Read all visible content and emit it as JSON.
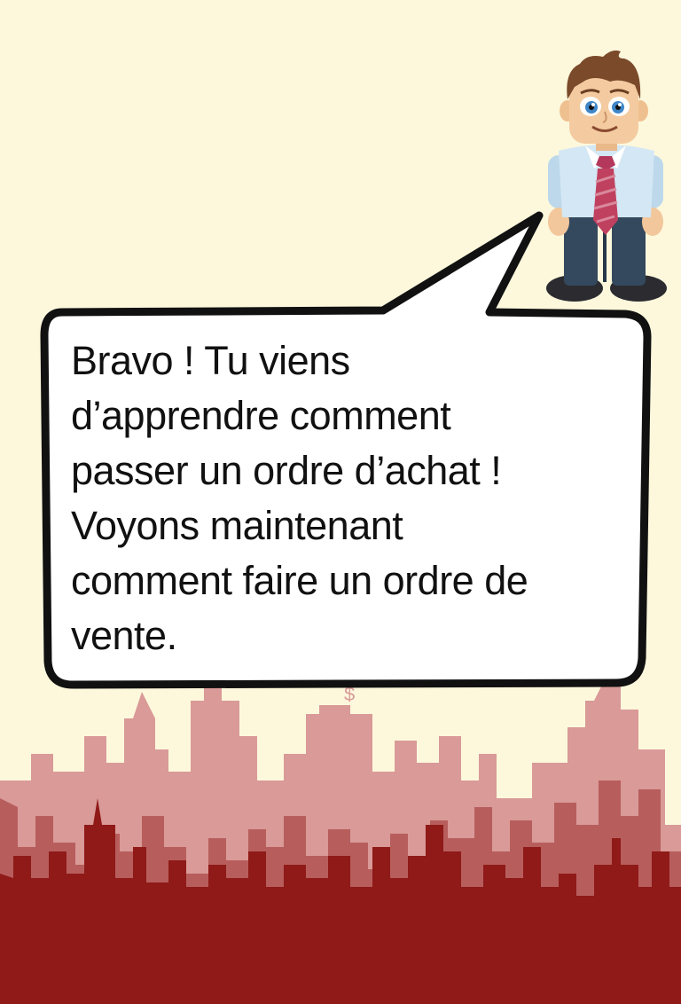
{
  "speech_bubble": {
    "lines": [
      "Bravo ! Tu viens",
      "d’apprendre comment",
      "passer un ordre d’achat !",
      "Voyons maintenant",
      "comment faire un ordre de",
      "vente."
    ]
  },
  "skyline": {
    "sign_text": "$"
  },
  "colors": {
    "background": "#fdf8dc",
    "skyline_back": "#d99a98",
    "skyline_mid": "#b75e5d",
    "skyline_front": "#8f1a18"
  },
  "icons": {
    "character": "businessman-cartoon-icon"
  }
}
